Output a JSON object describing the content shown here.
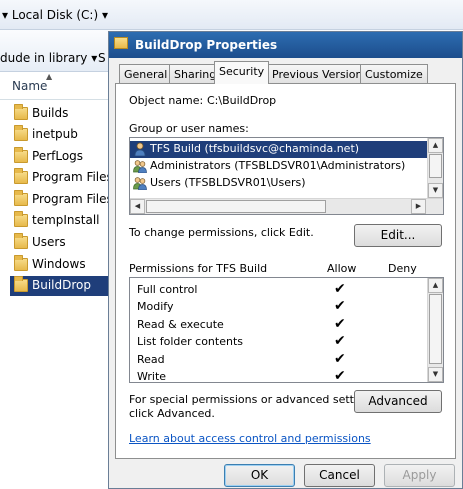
{
  "explorer": {
    "breadcrumb": "▾  Local Disk (C:)  ▾",
    "toolbar_include": "dude in library  ▾",
    "toolbar_share": "S",
    "column_name": "Name",
    "folders": [
      {
        "label": "Builds",
        "selected": false
      },
      {
        "label": "inetpub",
        "selected": false
      },
      {
        "label": "PerfLogs",
        "selected": false
      },
      {
        "label": "Program Files",
        "selected": false
      },
      {
        "label": "Program Files (x",
        "selected": false
      },
      {
        "label": "tempInstall",
        "selected": false
      },
      {
        "label": "Users",
        "selected": false
      },
      {
        "label": "Windows",
        "selected": false
      },
      {
        "label": "BuildDrop",
        "selected": true
      }
    ]
  },
  "dialog": {
    "title": "BuildDrop Properties",
    "tabs": [
      {
        "label": "General"
      },
      {
        "label": "Sharing"
      },
      {
        "label": "Security"
      },
      {
        "label": "Previous Versions"
      },
      {
        "label": "Customize"
      }
    ],
    "active_tab": "Security",
    "object_name_label": "Object name:",
    "object_name_value": "C:\\BuildDrop",
    "group_label": "Group or user names:",
    "users": [
      {
        "label": "TFS Build (tfsbuildsvc@chaminda.net)",
        "icon": "user-icon",
        "selected": true
      },
      {
        "label": "Administrators (TFSBLDSVR01\\Administrators)",
        "icon": "group-icon",
        "selected": false
      },
      {
        "label": "Users (TFSBLDSVR01\\Users)",
        "icon": "group-icon",
        "selected": false
      }
    ],
    "change_text": "To change permissions, click Edit.",
    "edit_button": "Edit...",
    "permissions_label": "Permissions for TFS Build",
    "allow_header": "Allow",
    "deny_header": "Deny",
    "check_glyph": "✔",
    "permissions": [
      {
        "name": "Full control",
        "allow": true,
        "deny": false
      },
      {
        "name": "Modify",
        "allow": true,
        "deny": false
      },
      {
        "name": "Read & execute",
        "allow": true,
        "deny": false
      },
      {
        "name": "List folder contents",
        "allow": true,
        "deny": false
      },
      {
        "name": "Read",
        "allow": true,
        "deny": false
      },
      {
        "name": "Write",
        "allow": true,
        "deny": false
      }
    ],
    "special_text_1": "For special permissions or advanced settings,",
    "special_text_2": "click Advanced.",
    "advanced_button": "Advanced",
    "learn_link": "Learn about access control and permissions",
    "ok_button": "OK",
    "cancel_button": "Cancel",
    "apply_button": "Apply"
  },
  "colors": {
    "selection": "#1f3e7a",
    "titlebar": "#2d6db1",
    "link": "#0b55c4"
  }
}
